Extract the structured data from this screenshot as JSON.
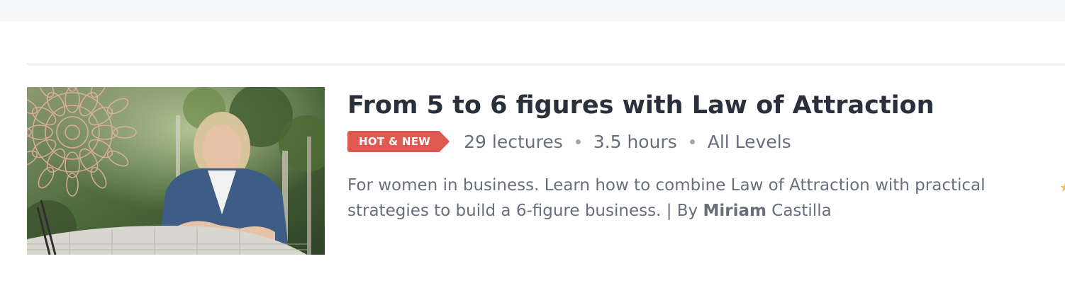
{
  "course": {
    "title": "From 5 to 6 figures with Law of Attraction",
    "badge": "HOT & NEW",
    "lectures": "29 lectures",
    "duration": "3.5 hours",
    "level": "All Levels",
    "description": "For women in business. Learn how to combine Law of Attraction with practical strategies to build a 6-figure business. | By ",
    "instructor_first": "Miriam",
    "instructor_last": " Castilla"
  },
  "colors": {
    "badge_bg": "#df5a52",
    "title": "#29303b",
    "meta": "#686f7a",
    "star": "#f4c150"
  },
  "icons": {
    "meta_separator": "bullet-dot-icon",
    "rating_star": "star-icon"
  }
}
